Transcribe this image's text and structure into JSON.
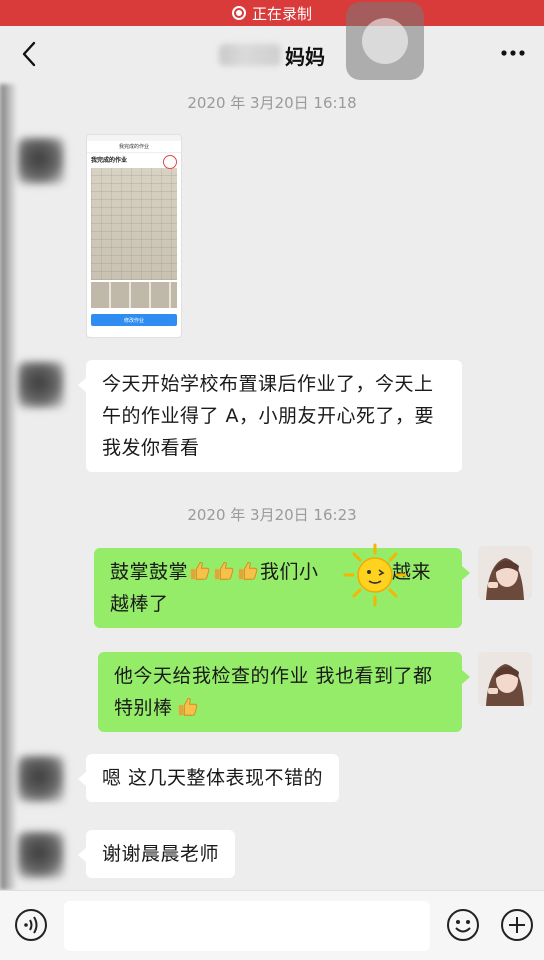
{
  "recording_banner": {
    "label": "正在录制"
  },
  "header": {
    "title": "妈妈"
  },
  "messages": [
    {
      "type": "timestamp",
      "text": "2020 年 3月20日 16:18"
    },
    {
      "type": "image",
      "sender": "left",
      "thumb_nav": "我完成的作业",
      "thumb_caption": "我完成的作业",
      "thumb_button": "修改作业"
    },
    {
      "type": "text",
      "sender": "left",
      "text": "今天开始学校布置课后作业了，今天上午的作业得了 A，小朋友开心死了，要我发你看看"
    },
    {
      "type": "timestamp",
      "text": "2020 年 3月20日 16:23"
    },
    {
      "type": "text",
      "sender": "right",
      "text_a": "鼓掌鼓掌",
      "text_b": "我们小",
      "text_c": "是越来越棒了",
      "emojis": [
        "thumbs-up",
        "thumbs-up",
        "thumbs-up",
        "sun"
      ]
    },
    {
      "type": "text",
      "sender": "right",
      "text": "他今天给我检查的作业  我也看到了都特别棒",
      "emojis": [
        "thumbs-up"
      ]
    },
    {
      "type": "text",
      "sender": "left",
      "text": "嗯  这几天整体表现不错的"
    },
    {
      "type": "text",
      "sender": "left",
      "text": "谢谢晨晨老师"
    }
  ],
  "input": {
    "value": "",
    "placeholder": ""
  },
  "icons": {
    "back": "back-icon",
    "more": "more-icon",
    "voice": "voice-icon",
    "emoji": "emoji-icon",
    "plus": "plus-icon",
    "thumbs_up": "thumbs-up-icon",
    "sun": "sun-icon"
  },
  "colors": {
    "banner": "#d93a3a",
    "bubble_right": "#95ec69",
    "bubble_left": "#ffffff",
    "background": "#ededed"
  }
}
